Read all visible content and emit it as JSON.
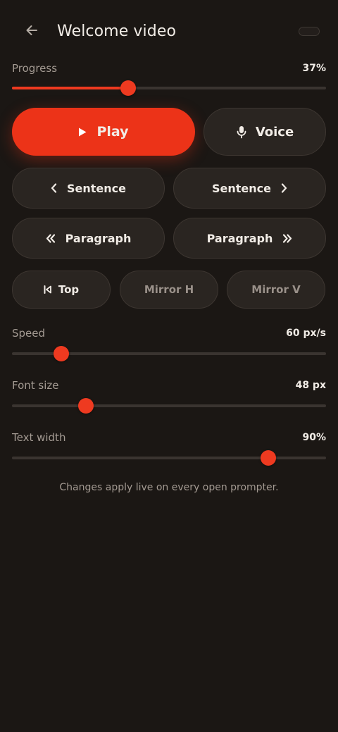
{
  "header": {
    "title": "Welcome video",
    "back_icon": "arrow-left-icon"
  },
  "progress": {
    "label": "Progress",
    "value_text": "37%",
    "fraction": 0.37
  },
  "transport": {
    "play_label": "Play",
    "play_icon": "play-icon",
    "voice_label": "Voice",
    "voice_icon": "microphone-icon"
  },
  "navigation": {
    "sentence_prev_label": "Sentence",
    "sentence_next_label": "Sentence",
    "paragraph_prev_label": "Paragraph",
    "paragraph_next_label": "Paragraph",
    "top_label": "Top",
    "mirror_h_label": "Mirror H",
    "mirror_v_label": "Mirror V"
  },
  "settings": {
    "speed": {
      "label": "Speed",
      "value_text": "60 px/s",
      "fraction": 0.157
    },
    "font_size": {
      "label": "Font size",
      "value_text": "48 px",
      "fraction": 0.235
    },
    "text_width": {
      "label": "Text width",
      "value_text": "90%",
      "fraction": 0.816
    }
  },
  "hint": "Changes apply live on every open prompter.",
  "colors": {
    "accent": "#ee3a20",
    "background": "#1b1714",
    "button_surface": "#2a2521",
    "track": "#3a3430"
  }
}
